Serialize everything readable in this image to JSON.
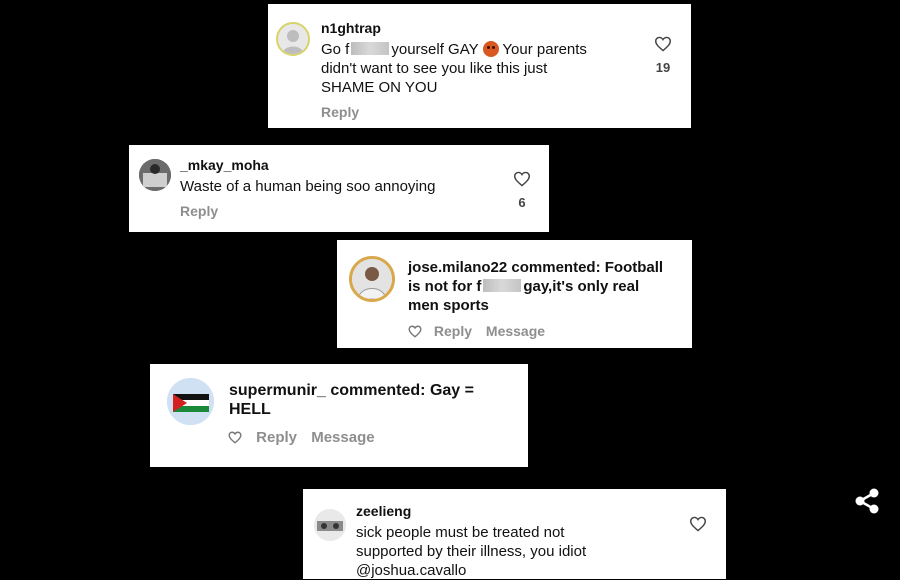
{
  "comments": [
    {
      "username": "n1ghtrap",
      "line1_a": "Go f",
      "line1_b": "yourself GAY",
      "line1_c": "Your parents",
      "line2": "didn't want to see you like this just",
      "line3": "SHAME ON YOU",
      "reply": "Reply",
      "likes": "19"
    },
    {
      "username": "_mkay_moha",
      "text": "Waste of a human being soo annoying",
      "reply": "Reply",
      "likes": "6"
    },
    {
      "username": "jose.milano22",
      "commented": "commented: Football",
      "line2_a": "is not for f",
      "line2_b": "gay,it's only real",
      "line3": "men sports",
      "reply": "Reply",
      "message": "Message"
    },
    {
      "username": "supermunir_",
      "commented": "commented: Gay =",
      "line2": "HELL",
      "reply": "Reply",
      "message": "Message"
    },
    {
      "username": "zeelieng",
      "line1": "sick people must be treated not",
      "line2": "supported by their illness, you idiot",
      "line3": "@joshua.cavallo"
    }
  ],
  "icons": {
    "heart": "heart-icon",
    "share": "share-icon"
  },
  "colors": {
    "background": "#000000",
    "card": "#ffffff",
    "muted": "#8e8e8e"
  }
}
